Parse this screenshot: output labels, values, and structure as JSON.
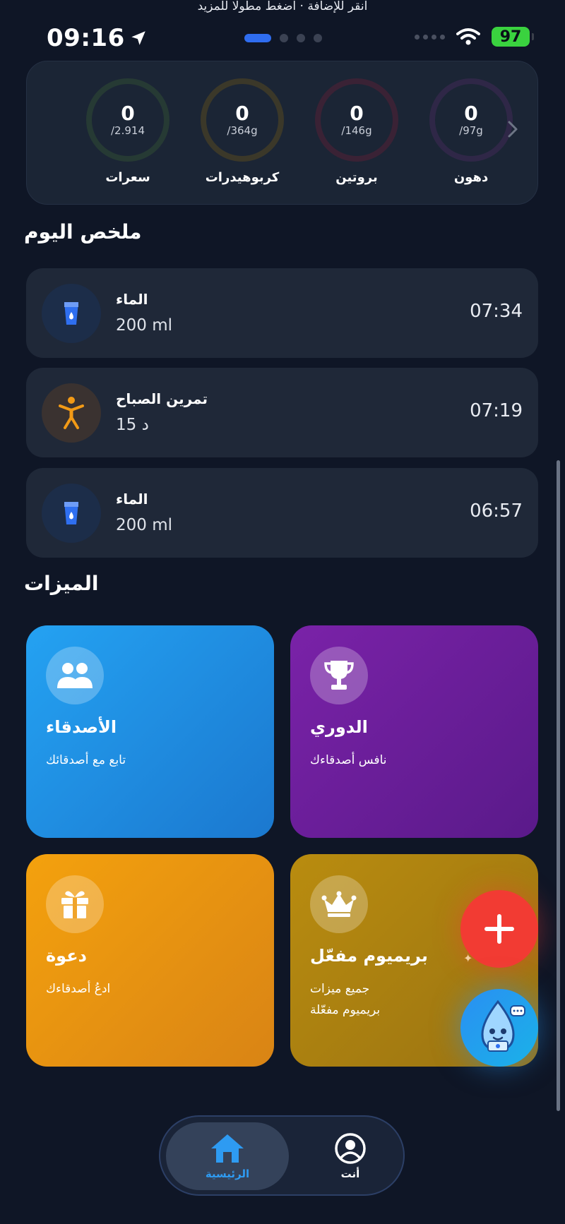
{
  "status_bar": {
    "hint": "انقر للإضافة · اضغط مطولا للمزيد",
    "time": "09:16",
    "battery": "97"
  },
  "macros": {
    "items": [
      {
        "value": "0",
        "goal": "/2.914",
        "label": "سعرات",
        "color": "#2b3a33"
      },
      {
        "value": "0",
        "goal": "/364g",
        "label": "كربوهيدرات",
        "color": "#3f3b2c"
      },
      {
        "value": "0",
        "goal": "/146g",
        "label": "بروتين",
        "color": "#3f2638"
      },
      {
        "value": "0",
        "goal": "/97g",
        "label": "دهون",
        "color": "#322a4c"
      }
    ]
  },
  "summary": {
    "title": "ملخص اليوم",
    "entries": [
      {
        "name": "الماء",
        "detail": "200 ml",
        "time": "07:34",
        "icon": "water-glass-icon"
      },
      {
        "name": "تمرين الصباح",
        "detail": "15 د",
        "time": "07:19",
        "icon": "exercise-person-icon"
      },
      {
        "name": "الماء",
        "detail": "200 ml",
        "time": "06:57",
        "icon": "water-glass-icon"
      }
    ]
  },
  "features": {
    "title": "الميزات",
    "friends": {
      "title": "الأصدقاء",
      "subtitle": "تابع مع أصدقائك"
    },
    "league": {
      "title": "الدوري",
      "subtitle": "نافس أصدقاءك"
    },
    "invite": {
      "title": "دعوة",
      "subtitle": "ادعُ أصدقاءك"
    },
    "premium": {
      "title": "بريميوم مفعّل",
      "subtitle": "جميع ميزات بريميوم مفعّلة"
    }
  },
  "nav": {
    "home": "الرئيسية",
    "you": "أنت"
  }
}
